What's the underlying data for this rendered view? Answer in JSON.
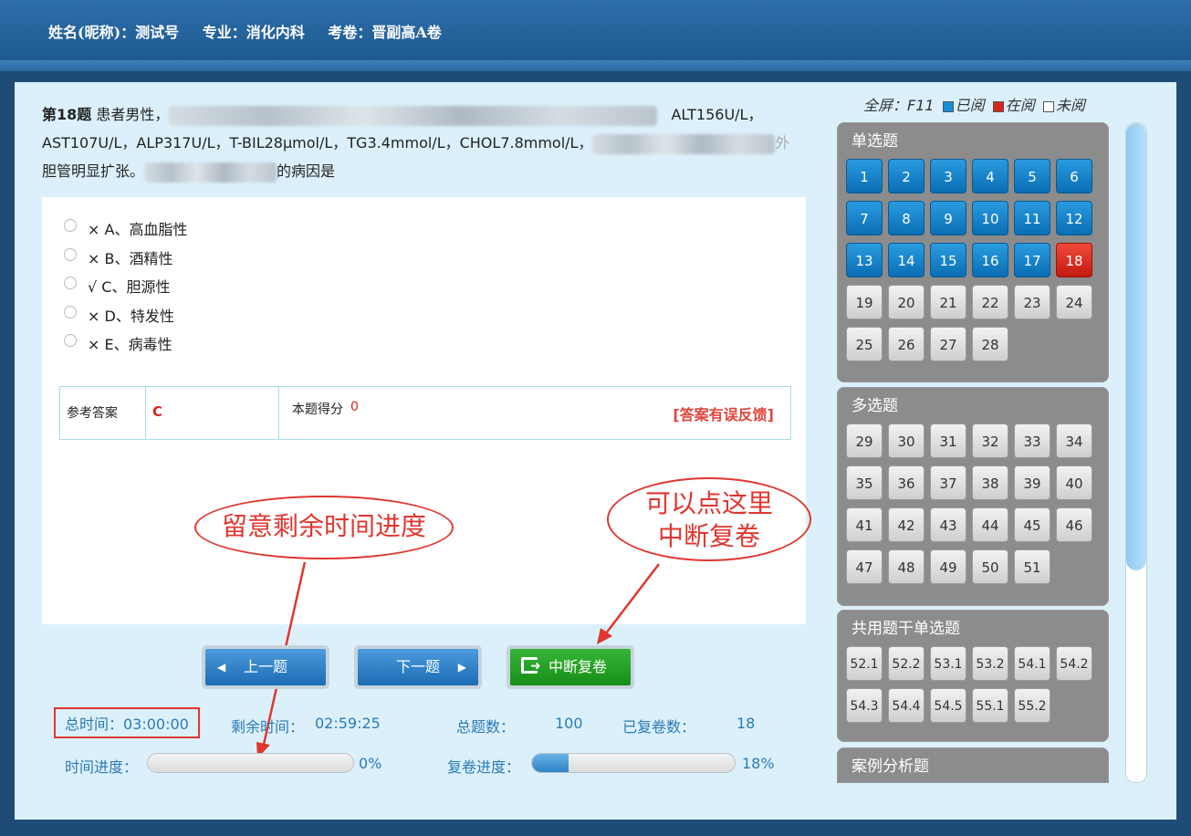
{
  "header": {
    "name": "姓名(昵称)：测试号",
    "major": "专业：消化内科",
    "exam": "考卷：晋副高A卷"
  },
  "question": {
    "number": "第18题",
    "text_a": "患者男性，",
    "text_b": "ALT156U/L，",
    "text_c": "AST107U/L，ALP317U/L，T-BIL28μmol/L，TG3.4mmol/L，CHOL7.8mmol/L，",
    "text_d": "外",
    "text_e": "胆管明显扩张。",
    "text_f": "的病因是"
  },
  "options": [
    {
      "mark": "×",
      "label": "A、高血脂性"
    },
    {
      "mark": "×",
      "label": "B、酒精性"
    },
    {
      "mark": "√",
      "label": "C、胆源性"
    },
    {
      "mark": "×",
      "label": "D、特发性"
    },
    {
      "mark": "×",
      "label": "E、病毒性"
    }
  ],
  "answer": {
    "ref_label": "参考答案",
    "ref_value": "C",
    "score_label": "本题得分",
    "score_value": "0",
    "feedback": "[答案有误反馈]"
  },
  "buttons": {
    "prev": "上一题",
    "next": "下一题",
    "interrupt": "中断复卷"
  },
  "stats": {
    "total_time": "总时间：03:00:00",
    "remain_label": "剩余时间：",
    "remain_value": "02:59:25",
    "total_count_label": "总题数：",
    "total_count_value": "100",
    "reviewed_label": "已复卷数：",
    "reviewed_value": "18",
    "time_progress_label": "时间进度：",
    "time_progress_value": "0%",
    "time_progress": 0,
    "review_progress_label": "复卷进度：",
    "review_progress_value": "18%",
    "review_progress": 0.18
  },
  "annotations": {
    "remaining_note": "留意剩余时间进度",
    "interrupt_note_1": "可以点这里",
    "interrupt_note_2": "中断复卷"
  },
  "legend": {
    "fullscreen": "全屏：F11",
    "read": "已阅",
    "reading": "在阅",
    "unread": "未阅",
    "colors": {
      "read": "#1390d6",
      "reading": "#d9261c",
      "unread": "#ffffff"
    }
  },
  "sections": [
    {
      "title": "单选题",
      "items": [
        "1",
        "2",
        "3",
        "4",
        "5",
        "6",
        "7",
        "8",
        "9",
        "10",
        "11",
        "12",
        "13",
        "14",
        "15",
        "16",
        "17",
        "18",
        "19",
        "20",
        "21",
        "22",
        "23",
        "24",
        "25",
        "26",
        "27",
        "28"
      ],
      "read_count": 17,
      "current": "18"
    },
    {
      "title": "多选题",
      "items": [
        "29",
        "30",
        "31",
        "32",
        "33",
        "34",
        "35",
        "36",
        "37",
        "38",
        "39",
        "40",
        "41",
        "42",
        "43",
        "44",
        "45",
        "46",
        "47",
        "48",
        "49",
        "50",
        "51"
      ]
    },
    {
      "title": "共用题干单选题",
      "items": [
        "52.1",
        "52.2",
        "53.1",
        "53.2",
        "54.1",
        "54.2",
        "54.3",
        "54.4",
        "54.5",
        "55.1",
        "55.2"
      ]
    },
    {
      "title": "案例分析题",
      "items": []
    }
  ]
}
